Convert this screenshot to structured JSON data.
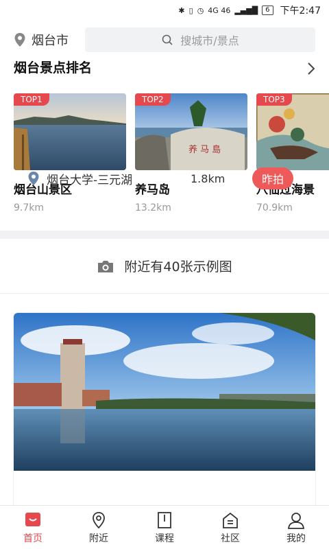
{
  "status": {
    "signal": "4G 46",
    "battery": "6",
    "time": "下午2:47"
  },
  "header": {
    "city": "烟台市",
    "search_placeholder": "搜城市/景点"
  },
  "ranking": {
    "title": "烟台景点排名",
    "items": [
      {
        "badge": "TOP1",
        "name": "烟台山景区",
        "distance": "9.7km"
      },
      {
        "badge": "TOP2",
        "name": "养马岛",
        "distance": "13.2km"
      },
      {
        "badge": "TOP3",
        "name": "八仙过海景",
        "distance": "70.9km"
      }
    ]
  },
  "nearby": {
    "text": "附近有40张示例图"
  },
  "photo": {
    "location": "烟台大学-三元湖",
    "distance": "1.8km",
    "tag": "昨拍"
  },
  "tabs": [
    {
      "label": "首页",
      "icon": "home-icon",
      "active": true
    },
    {
      "label": "附近",
      "icon": "nearby-pin-icon",
      "active": false
    },
    {
      "label": "课程",
      "icon": "course-book-icon",
      "active": false
    },
    {
      "label": "社区",
      "icon": "community-icon",
      "active": false
    },
    {
      "label": "我的",
      "icon": "profile-icon",
      "active": false
    }
  ],
  "colors": {
    "accent": "#e5484d",
    "tag": "#ee5a5a",
    "search_bg": "#f1f2f4"
  }
}
